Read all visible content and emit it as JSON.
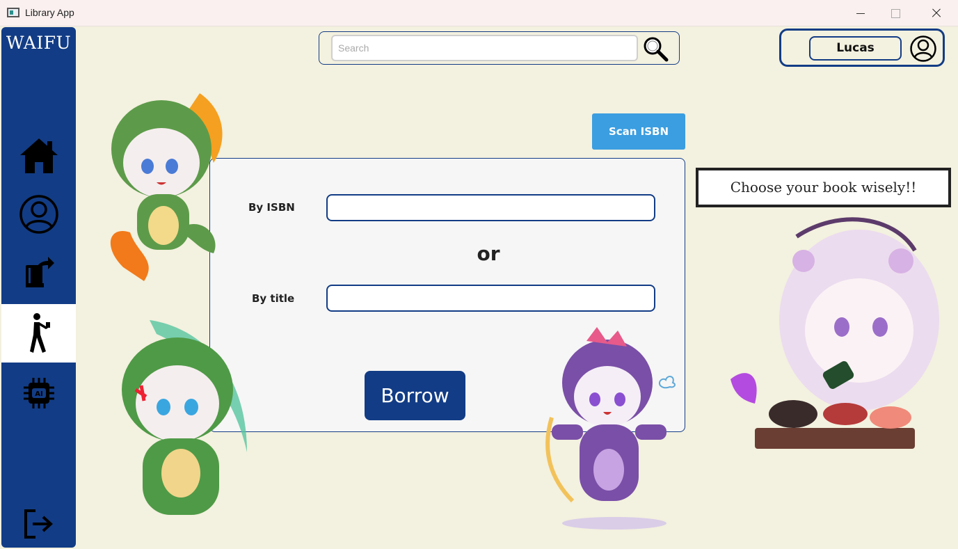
{
  "window": {
    "title": "Library App"
  },
  "sidebar": {
    "brand": "WAIFU",
    "items": [
      {
        "id": "home",
        "icon": "home-icon"
      },
      {
        "id": "profile",
        "icon": "user-circle-icon"
      },
      {
        "id": "books",
        "icon": "book-share-icon"
      },
      {
        "id": "borrow",
        "icon": "walking-person-icon",
        "active": true
      },
      {
        "id": "ai",
        "icon": "ai-chip-icon"
      },
      {
        "id": "logout",
        "icon": "logout-icon"
      }
    ]
  },
  "search": {
    "placeholder": "Search",
    "value": ""
  },
  "user": {
    "name": "Lucas"
  },
  "actions": {
    "scan_label": "Scan ISBN"
  },
  "form": {
    "isbn_label": "By ISBN",
    "isbn_value": "",
    "or_label": "or",
    "title_label": "By title",
    "title_value": "",
    "borrow_label": "Borrow"
  },
  "quote": "Choose your book wisely!!",
  "colors": {
    "primary": "#123c85",
    "accent": "#3b9ee0",
    "background": "#f3f1df",
    "panel": "#f6f6f6"
  }
}
